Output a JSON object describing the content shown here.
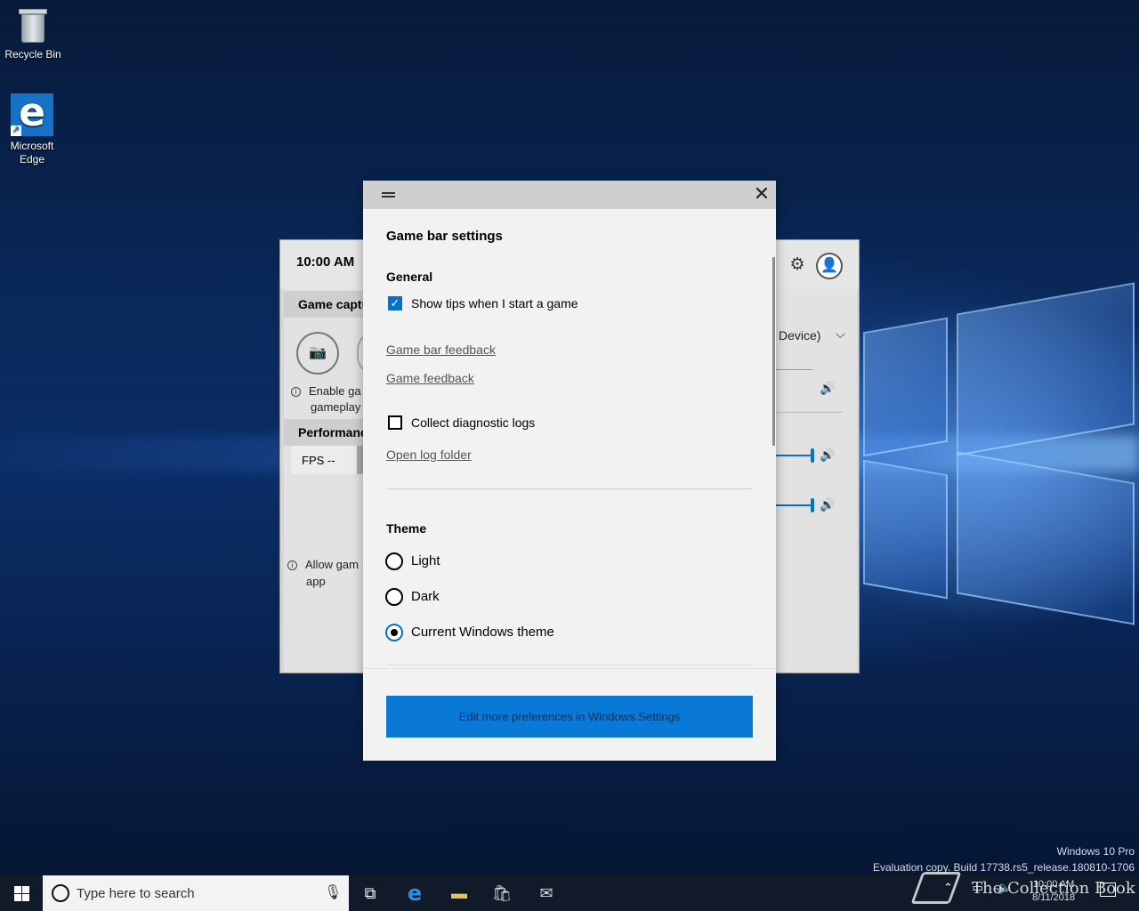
{
  "desktop": {
    "icons": [
      {
        "label": "Recycle Bin",
        "icon": "recycle-bin-icon"
      },
      {
        "label": "Microsoft Edge",
        "icon": "edge-icon"
      }
    ],
    "watermark": {
      "edition": "Windows 10 Pro",
      "build": "Evaluation copy. Build 17738.rs5_release.180810-1706"
    },
    "overlay_watermark": "The Collection Book"
  },
  "gamebar": {
    "time": "10:00 AM",
    "capture_heading": "Game captu",
    "capture_info": [
      "Enable ga",
      "gameplay"
    ],
    "performance_heading": "Performanc",
    "fps": "FPS --",
    "allow_info": [
      "Allow gam",
      "app"
    ],
    "audio_device": "Device)",
    "icons": [
      "gear-icon",
      "avatar-icon",
      "camera-icon",
      "speaker-icon",
      "chevron-down-icon"
    ]
  },
  "dialog": {
    "title": "Game bar settings",
    "general_heading": "General",
    "show_tips_label": "Show tips when I start a game",
    "show_tips_checked": true,
    "links": {
      "gamebar_feedback": "Game bar feedback",
      "game_feedback": "Game feedback",
      "open_log_folder": "Open log folder"
    },
    "collect_logs_label": "Collect diagnostic logs",
    "collect_logs_checked": false,
    "theme_heading": "Theme",
    "theme_options": [
      {
        "label": "Light",
        "selected": false
      },
      {
        "label": "Dark",
        "selected": false
      },
      {
        "label": "Current Windows theme",
        "selected": true
      }
    ],
    "primary_button": "Edit more preferences in Windows Settings",
    "accent_color": "#0a78d7"
  },
  "taskbar": {
    "search_placeholder": "Type here to search",
    "apps": [
      "task-view-icon",
      "edge-icon",
      "file-explorer-icon",
      "store-icon",
      "mail-icon"
    ],
    "clock_time": "10:00 AM",
    "clock_date": "8/11/2018"
  }
}
